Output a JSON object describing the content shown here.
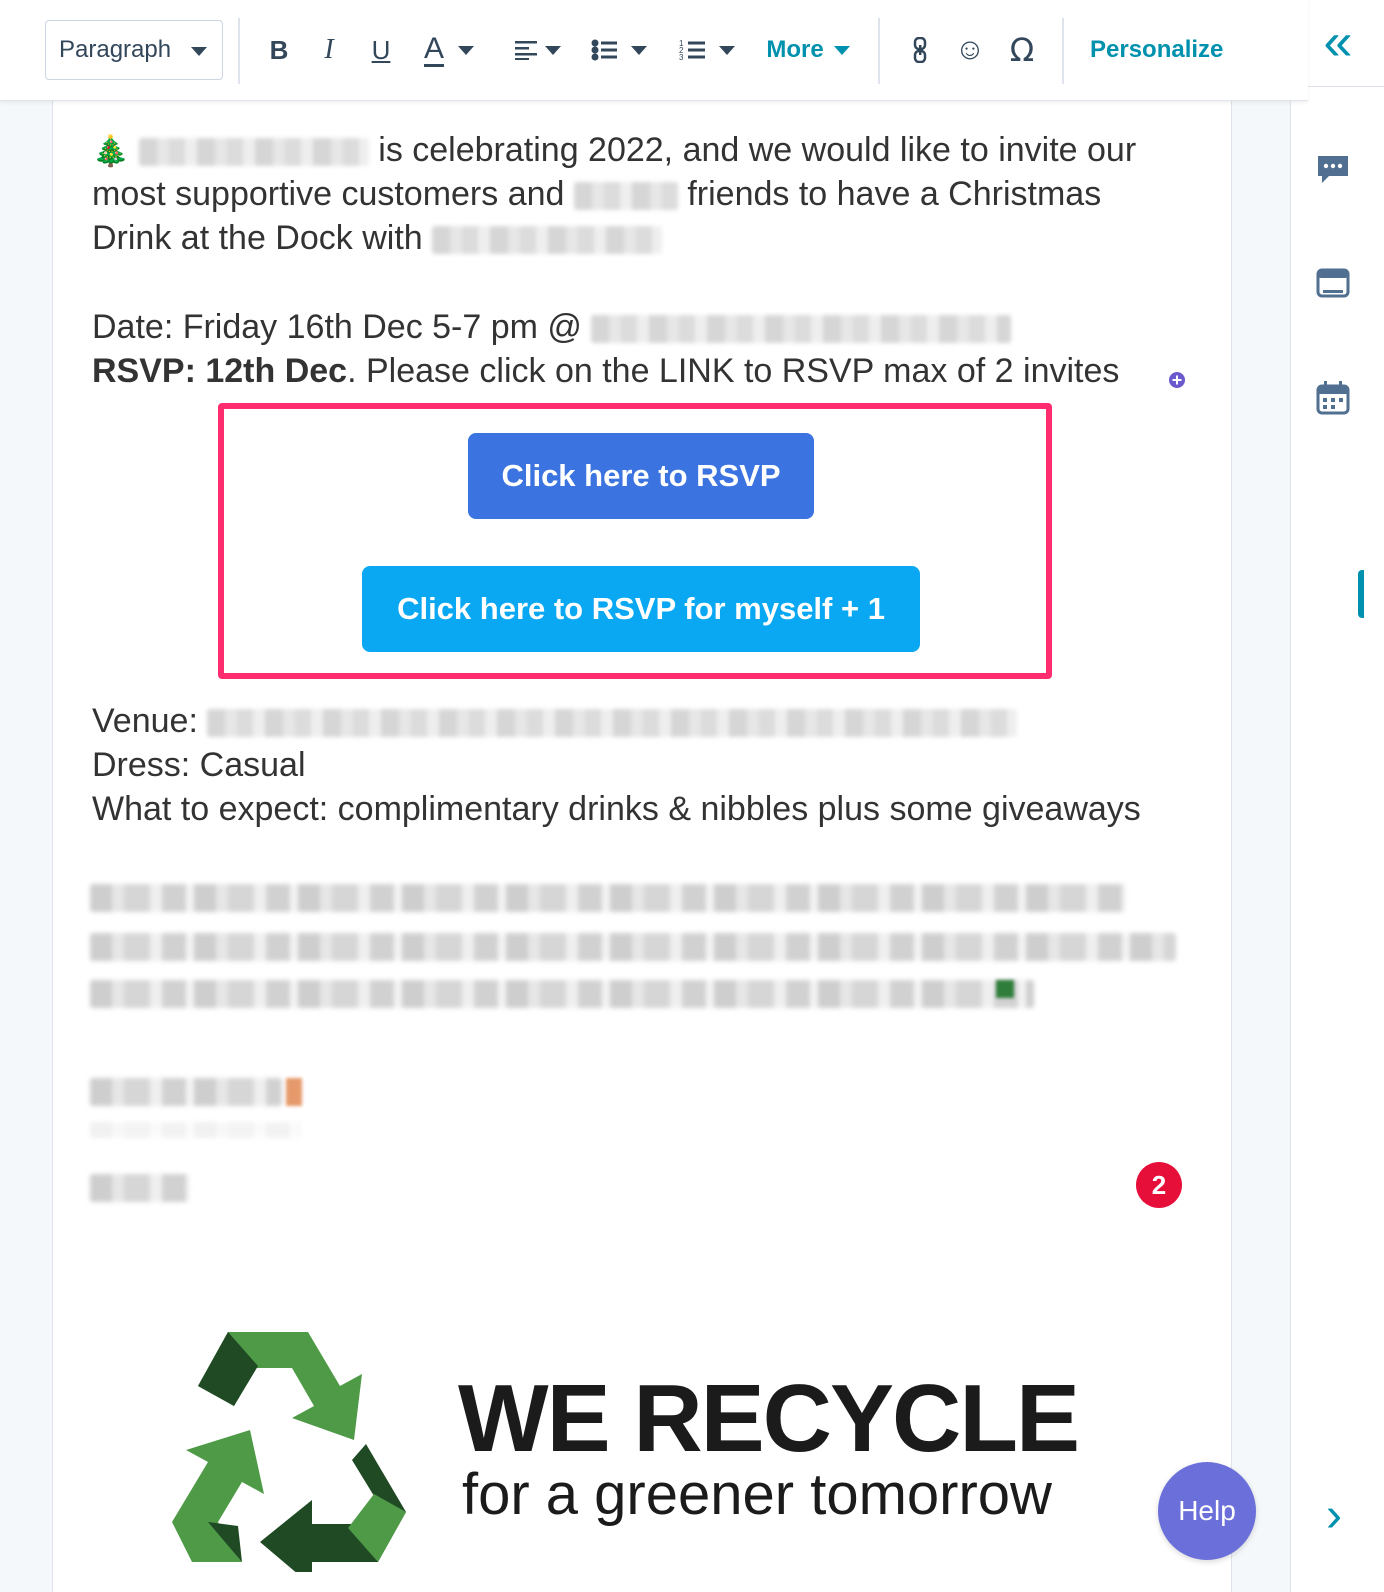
{
  "toolbar": {
    "paragraph_select": "Paragraph",
    "bold_glyph": "B",
    "italic_glyph": "I",
    "underline_glyph": "U",
    "text_color_glyph": "A",
    "more_label": "More",
    "link_glyph": "⛓",
    "emoji_glyph": "☺",
    "special_char_glyph": "Ω",
    "personalize_label": "Personalize"
  },
  "rail": {
    "collapse_glyph": "«",
    "expand_glyph": "›",
    "icons": [
      "comment-icon",
      "template-icon",
      "calendar-icon"
    ]
  },
  "email": {
    "tree_emoji": "🎄",
    "line1_rest": "is celebrating 2022, and we would like to invite our",
    "line2_a": "most supportive customers and",
    "line2_b": "friends to have a Christmas",
    "line3": "Drink at the Dock with",
    "date_line": "Date: Friday 16th Dec 5-7 pm @",
    "rsvp_bold": "RSVP: 12th Dec",
    "rsvp_rest": ".  Please click on the LINK to RSVP max of 2 invites",
    "button_primary": "Click here to RSVP",
    "button_secondary": "Click here to RSVP for myself + 1",
    "venue_label": "Venue:",
    "dress_line": "Dress: Casual",
    "expect_line": "What to expect: complimentary drinks & nibbles plus some giveaways"
  },
  "badge_count": "2",
  "help_label": "Help",
  "logo": {
    "title": "WE RECYCLE",
    "subtitle": "for a greener tomorrow"
  },
  "colors": {
    "accent_teal": "#0091ae",
    "rsvp_primary": "#3b73e0",
    "rsvp_secondary": "#0aa8f2",
    "highlight_border": "#ff2d6f",
    "badge_red": "#e60f3a",
    "help_purple": "#6b6fd9"
  }
}
